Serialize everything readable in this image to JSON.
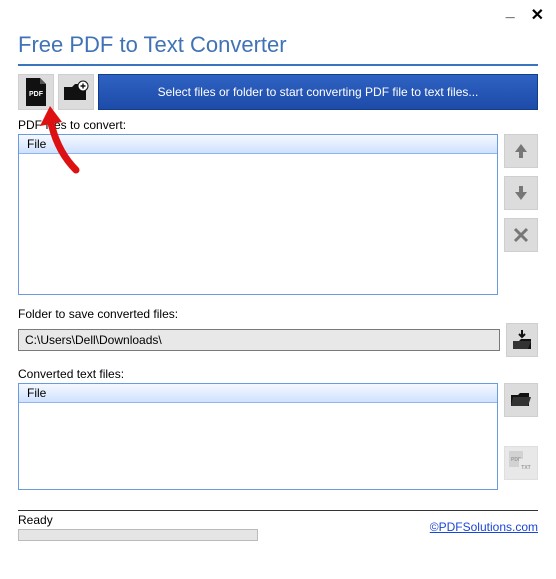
{
  "windowControls": {
    "minimize": "_",
    "close": "✕"
  },
  "title": "Free PDF to Text Converter",
  "toolbar": {
    "pdfIconLabel": "PDF",
    "selectMessage": "Select files or folder to start converting PDF file to text files..."
  },
  "labels": {
    "filesToConvert": "PDF files to convert:",
    "folderToSave": "Folder to save converted files:",
    "convertedFiles": "Converted text files:",
    "fileHeader": "File"
  },
  "folderPath": "C:\\Users\\Dell\\Downloads\\",
  "status": "Ready",
  "link": "©PDFSolutions.com"
}
